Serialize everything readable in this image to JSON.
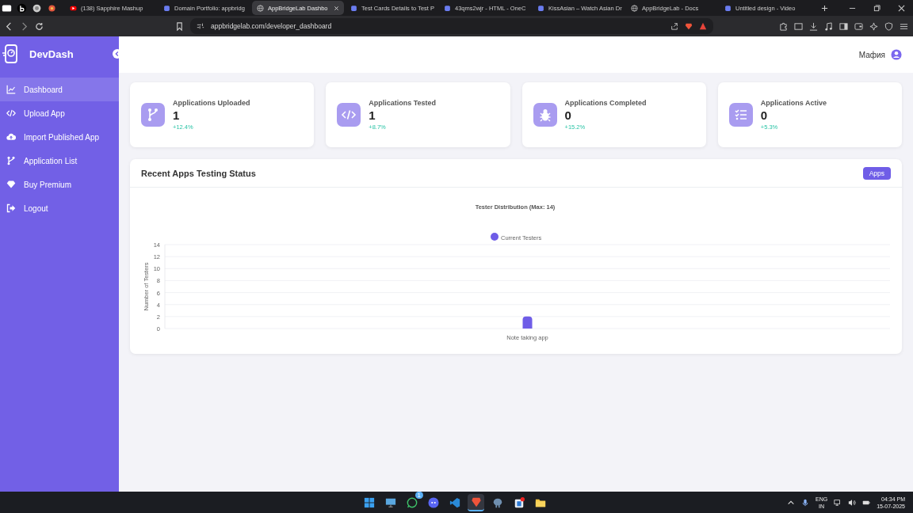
{
  "browser": {
    "tabs": [
      {
        "title": "(138) Sapphire Mashup",
        "selected": false
      },
      {
        "title": "Domain Portfolio: appbridg",
        "selected": false
      },
      {
        "title": "AppBridgeLab Dashbo",
        "selected": true
      },
      {
        "title": "Test Cards Details to Test P",
        "selected": false
      },
      {
        "title": "43qms2wjr - HTML - OneC",
        "selected": false
      },
      {
        "title": "KissAsian – Watch Asian Dr",
        "selected": false
      },
      {
        "title": "AppBridgeLab - Docs",
        "selected": false
      },
      {
        "title": "Untitled design - Video",
        "selected": false
      }
    ],
    "url": "appbridgelab.com/developer_dashboard"
  },
  "sidebar": {
    "brand": "DevDash",
    "items": [
      {
        "label": "Dashboard",
        "selected": true
      },
      {
        "label": "Upload App",
        "selected": false
      },
      {
        "label": "Import Published App",
        "selected": false
      },
      {
        "label": "Application List",
        "selected": false
      },
      {
        "label": "Buy Premium",
        "selected": false
      },
      {
        "label": "Logout",
        "selected": false
      }
    ]
  },
  "header": {
    "user": "Мафия"
  },
  "stats": [
    {
      "title": "Applications Uploaded",
      "value": "1",
      "change": "+12.4%"
    },
    {
      "title": "Applications Tested",
      "value": "1",
      "change": "+8.7%"
    },
    {
      "title": "Applications Completed",
      "value": "0",
      "change": "+15.2%"
    },
    {
      "title": "Applications Active",
      "value": "0",
      "change": "+5.3%"
    }
  ],
  "panel": {
    "title": "Recent Apps Testing Status",
    "button": "Apps",
    "chart_data": {
      "type": "bar",
      "title": "Tester Distribution (Max: 14)",
      "ylabel": "Number of Testers",
      "categories": [
        "Note taking app"
      ],
      "series": [
        {
          "name": "Current Testers",
          "color": "#6f5de7",
          "values": [
            2
          ]
        }
      ],
      "ylim": [
        0,
        14
      ],
      "yticks": [
        0,
        2,
        4,
        6,
        8,
        10,
        12,
        14
      ],
      "grid": true
    }
  },
  "taskbar": {
    "apps": [
      {
        "selected": false
      },
      {
        "selected": false
      },
      {
        "selected": false,
        "badge": "1"
      },
      {
        "selected": false
      },
      {
        "selected": false
      },
      {
        "selected": true
      },
      {
        "selected": false
      },
      {
        "selected": false
      },
      {
        "selected": false
      }
    ],
    "language": "ENG",
    "region": "IN",
    "time": "04:34 PM",
    "date": "15-07-2025"
  }
}
